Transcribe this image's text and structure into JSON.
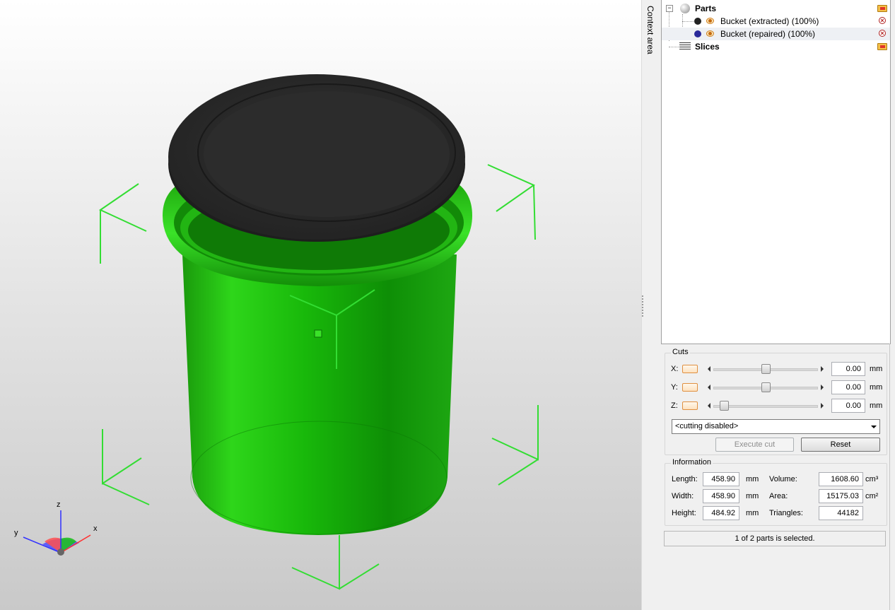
{
  "sidebar": {
    "context_label": "Context area"
  },
  "tree": {
    "parts_label": "Parts",
    "items": [
      {
        "label": "Bucket (extracted) (100%)",
        "color": "#222222"
      },
      {
        "label": "Bucket (repaired) (100%)",
        "color": "#2a2a9a"
      }
    ],
    "slices_label": "Slices"
  },
  "cuts": {
    "title": "Cuts",
    "axes": [
      {
        "label": "X:",
        "value": "0.00",
        "unit": "mm",
        "position": 0.5
      },
      {
        "label": "Y:",
        "value": "0.00",
        "unit": "mm",
        "position": 0.5
      },
      {
        "label": "Z:",
        "value": "0.00",
        "unit": "mm",
        "position": 0.0
      }
    ],
    "mode": "<cutting disabled>",
    "execute_label": "Execute cut",
    "reset_label": "Reset"
  },
  "info": {
    "title": "Information",
    "length_label": "Length:",
    "length_value": "458.90",
    "length_unit": "mm",
    "width_label": "Width:",
    "width_value": "458.90",
    "width_unit": "mm",
    "height_label": "Height:",
    "height_value": "484.92",
    "height_unit": "mm",
    "volume_label": "Volume:",
    "volume_value": "1608.60",
    "volume_unit": "cm³",
    "area_label": "Area:",
    "area_value": "15175.03",
    "area_unit": "cm²",
    "triangles_label": "Triangles:",
    "triangles_value": "44182"
  },
  "status": "1 of 2 parts is selected.",
  "axes_gizmo": {
    "x": "x",
    "y": "y",
    "z": "z"
  },
  "colors": {
    "model_green": "#22c50f",
    "lid": "#2b2b2b",
    "bbox": "#33dd33"
  }
}
